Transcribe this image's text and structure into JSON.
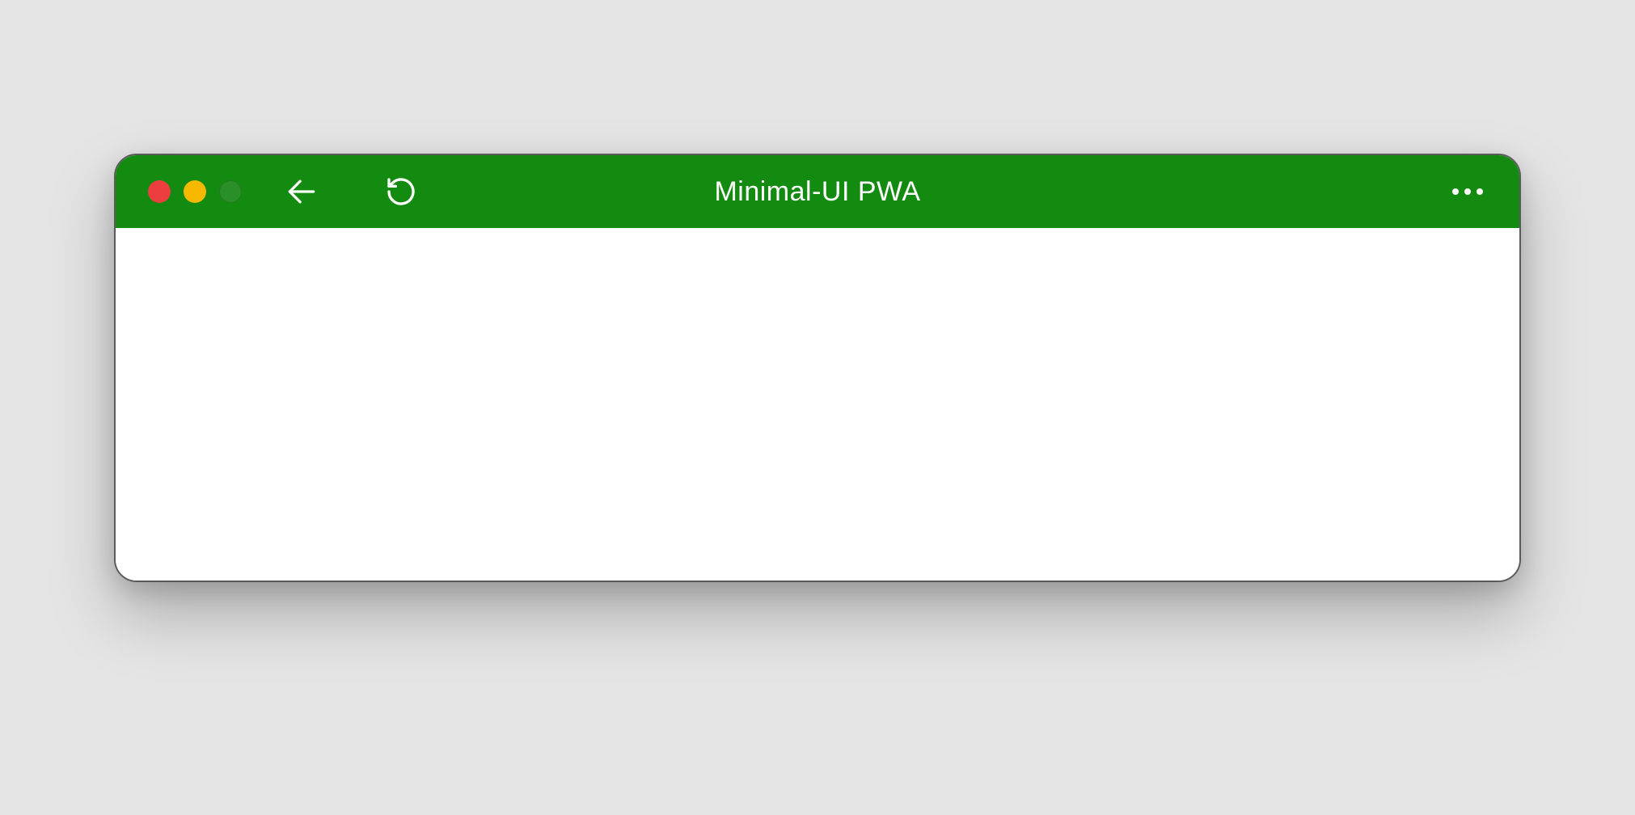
{
  "window": {
    "title": "Minimal-UI PWA",
    "theme_color": "#138a10",
    "traffic_lights": {
      "close": "#ec3e3e",
      "minimize": "#f6b900",
      "maximize": "#2a8f27"
    },
    "icons": {
      "back": "arrow-left-icon",
      "reload": "reload-icon",
      "menu": "more-horizontal-icon"
    }
  }
}
